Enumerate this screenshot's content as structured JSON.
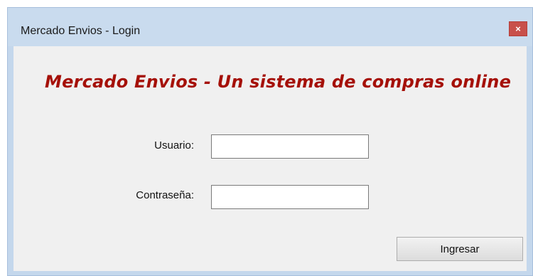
{
  "window": {
    "title": "Mercado Envios - Login",
    "close_glyph": "×",
    "close_icon": "close-icon"
  },
  "form": {
    "heading": "Mercado Envios - Un sistema de compras online",
    "username_label": "Usuario:",
    "username_value": "",
    "password_label": "Contraseña:",
    "password_value": "",
    "submit_label": "Ingresar"
  },
  "colors": {
    "heading": "#a51008",
    "title_bar": "#c9dbee",
    "close_button": "#c8504b",
    "client_background": "#f0f0f0"
  }
}
